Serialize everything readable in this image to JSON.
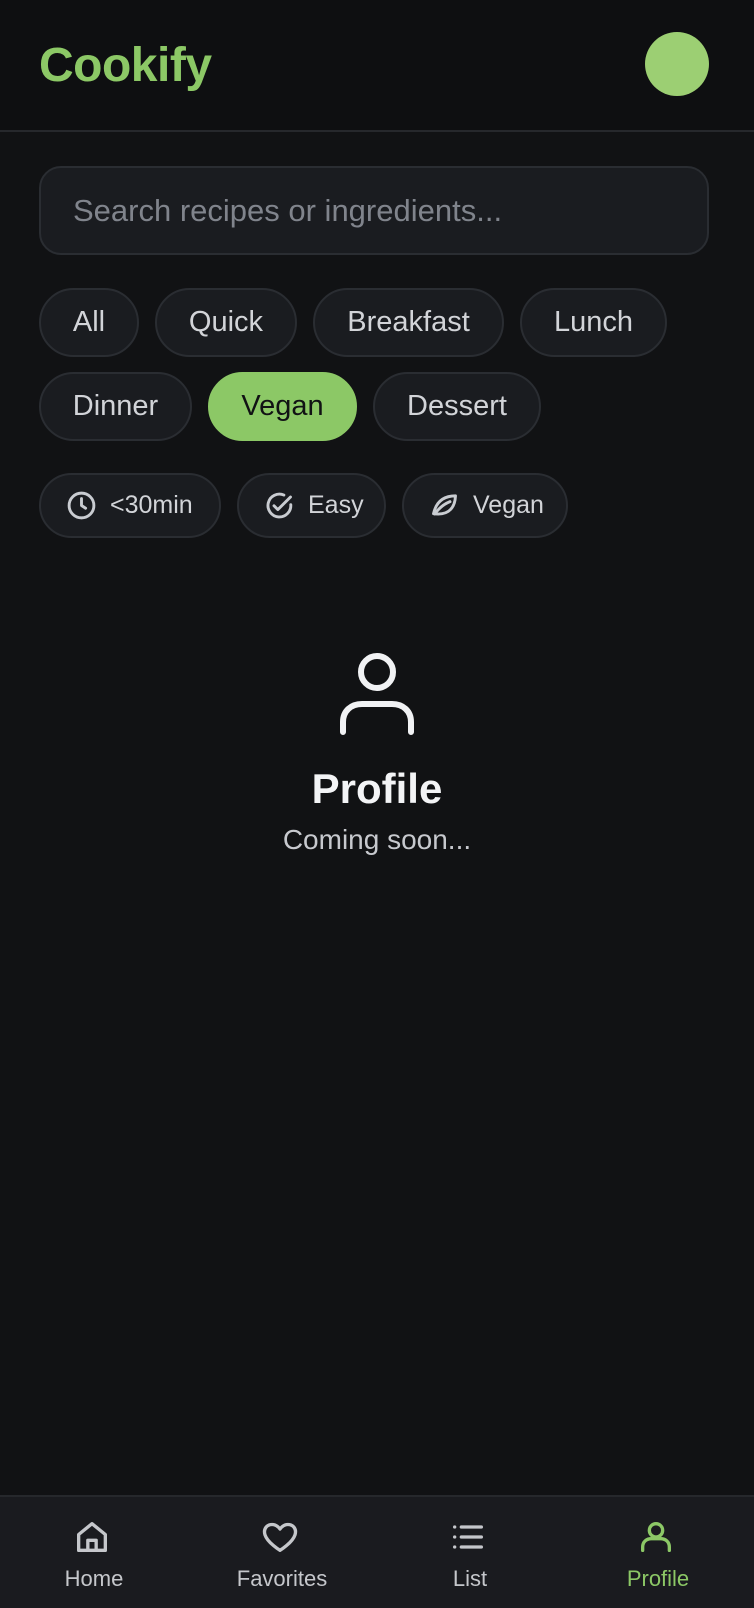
{
  "app": {
    "title": "Cookify"
  },
  "search": {
    "placeholder": "Search recipes or ingredients...",
    "value": ""
  },
  "categories": [
    {
      "label": "All",
      "active": false
    },
    {
      "label": "Quick",
      "active": false
    },
    {
      "label": "Breakfast",
      "active": false
    },
    {
      "label": "Lunch",
      "active": false
    },
    {
      "label": "Dinner",
      "active": false
    },
    {
      "label": "Vegan",
      "active": true
    },
    {
      "label": "Dessert",
      "active": false
    }
  ],
  "filters": [
    {
      "label": "<30min",
      "icon": "clock-icon"
    },
    {
      "label": "Easy",
      "icon": "check-circle-icon"
    },
    {
      "label": "Vegan",
      "icon": "leaf-icon"
    }
  ],
  "empty_state": {
    "icon": "user-icon",
    "title": "Profile",
    "subtitle": "Coming soon..."
  },
  "bottom_nav": [
    {
      "label": "Home",
      "icon": "home-icon",
      "active": false
    },
    {
      "label": "Favorites",
      "icon": "heart-icon",
      "active": false
    },
    {
      "label": "List",
      "icon": "list-icon",
      "active": false
    },
    {
      "label": "Profile",
      "icon": "user-icon",
      "active": true
    }
  ],
  "colors": {
    "background": "#111214",
    "accent": "#8cc866",
    "surface": "#1a1c20",
    "border": "#2a2d32",
    "text": "#e8e8ea"
  }
}
